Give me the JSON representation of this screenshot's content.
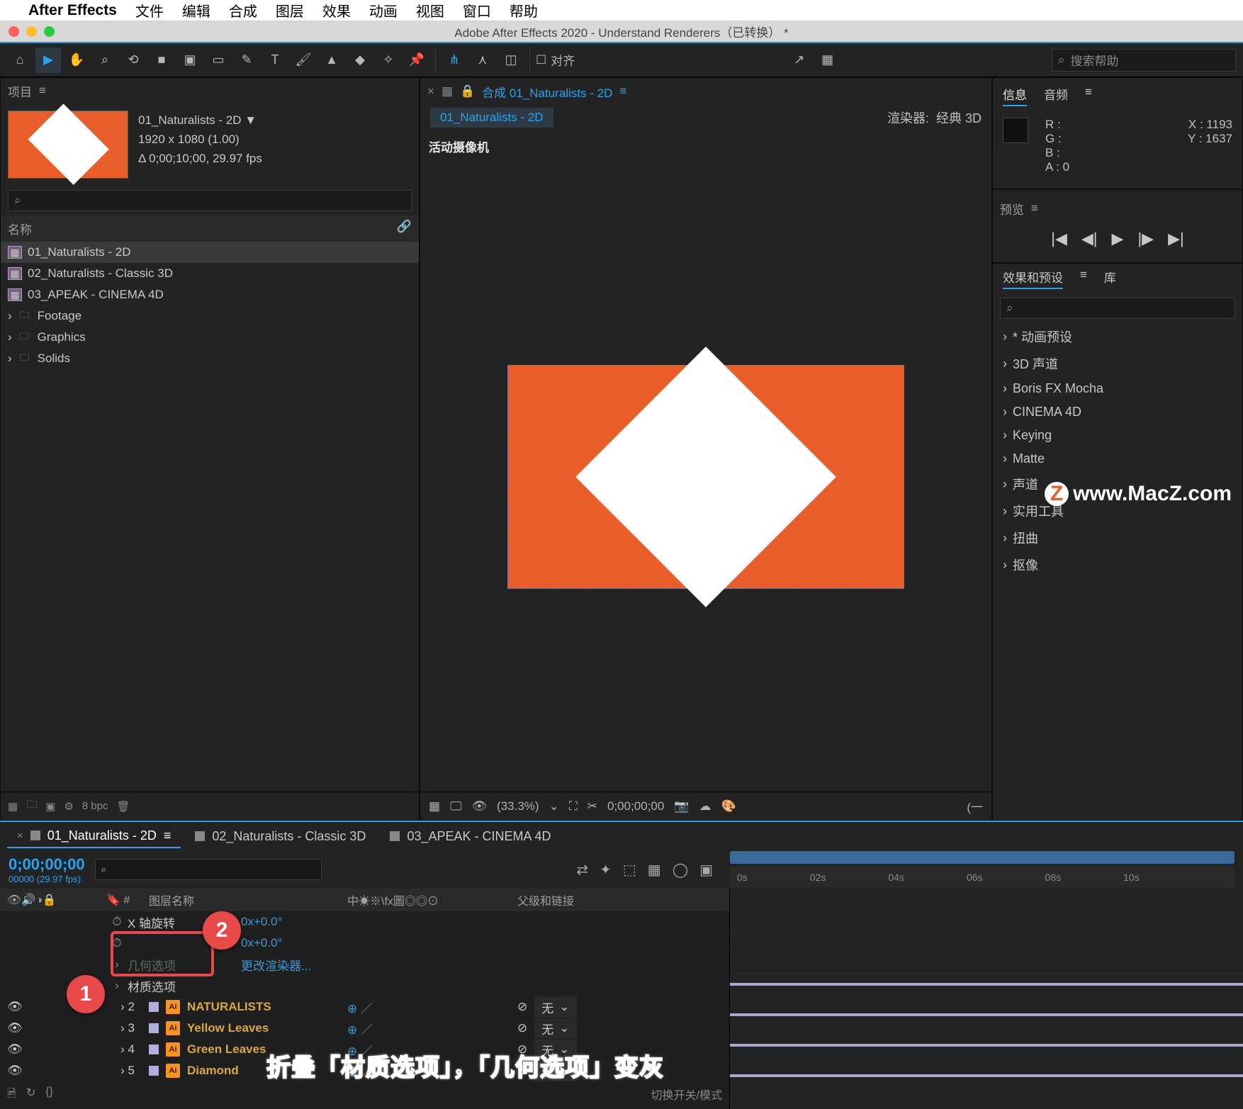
{
  "menubar": {
    "app": "After Effects",
    "items": [
      "文件",
      "编辑",
      "合成",
      "图层",
      "效果",
      "动画",
      "视图",
      "窗口",
      "帮助"
    ]
  },
  "window_title": "Adobe After Effects 2020 - Understand Renderers（已转换） *",
  "toolbar": {
    "align": "对齐",
    "search_placeholder": "搜索帮助"
  },
  "project": {
    "title": "项目",
    "selected_name": "01_Naturalists - 2D ▼",
    "dims": "1920 x 1080 (1.00)",
    "dur": "Δ 0;00;10;00, 29.97 fps",
    "col_name": "名称",
    "items": [
      {
        "type": "comp",
        "label": "01_Naturalists - 2D",
        "sel": true
      },
      {
        "type": "comp",
        "label": "02_Naturalists - Classic 3D"
      },
      {
        "type": "comp",
        "label": "03_APEAK - CINEMA 4D"
      },
      {
        "type": "folder",
        "label": "Footage"
      },
      {
        "type": "folder",
        "label": "Graphics"
      },
      {
        "type": "folder",
        "label": "Solids"
      }
    ],
    "bpc": "8 bpc"
  },
  "composition": {
    "tab": "合成 01_Naturalists - 2D",
    "crumb": "01_Naturalists - 2D",
    "renderer_label": "渲染器:",
    "renderer_value": "经典 3D",
    "camera": "活动摄像机",
    "footer": {
      "zoom": "(33.3%)",
      "time": "0;00;00;00"
    }
  },
  "info": {
    "tab_info": "信息",
    "tab_audio": "音频",
    "r": "R :",
    "g": "G :",
    "b": "B :",
    "a": "A : 0",
    "x": "X : 1193",
    "y": "Y : 1637"
  },
  "preview": {
    "title": "预览"
  },
  "effects": {
    "tab_eff": "效果和预设",
    "tab_lib": "库",
    "items": [
      "* 动画预设",
      "3D 声道",
      "Boris FX Mocha",
      "CINEMA 4D",
      "Keying",
      "Matte",
      "声道",
      "实用工具",
      "扭曲",
      "抠像"
    ]
  },
  "watermark": "www.MacZ.com",
  "timeline": {
    "tabs": [
      {
        "label": "01_Naturalists - 2D",
        "active": true
      },
      {
        "label": "02_Naturalists - Classic 3D"
      },
      {
        "label": "03_APEAK - CINEMA 4D"
      }
    ],
    "timecode": "0;00;00;00",
    "frame_info": "00000 (29.97 fps)",
    "ruler": [
      "0s",
      "02s",
      "04s",
      "06s",
      "08s",
      "10s"
    ],
    "col_layer": "图层名称",
    "col_parent": "父级和链接",
    "col_switches": "中☀※\\fx圖◎◎⊙",
    "prop_xrot": "X 轴旋转",
    "prop_val1": "0x+0.0°",
    "prop_val2": "0x+0.0°",
    "prop_geo": "几何选项",
    "prop_mat": "材质选项",
    "change_renderer": "更改渲染器...",
    "layers": [
      {
        "n": "2",
        "name": "NATURALISTS"
      },
      {
        "n": "3",
        "name": "Yellow Leaves"
      },
      {
        "n": "4",
        "name": "Green Leaves"
      },
      {
        "n": "5",
        "name": "Diamond"
      }
    ],
    "parent_none": "无",
    "toggle": "切换开关/模式"
  },
  "annotation": "折叠「材质选项」，「几何选项」变灰",
  "badges": {
    "b1": "1",
    "b2": "2"
  }
}
